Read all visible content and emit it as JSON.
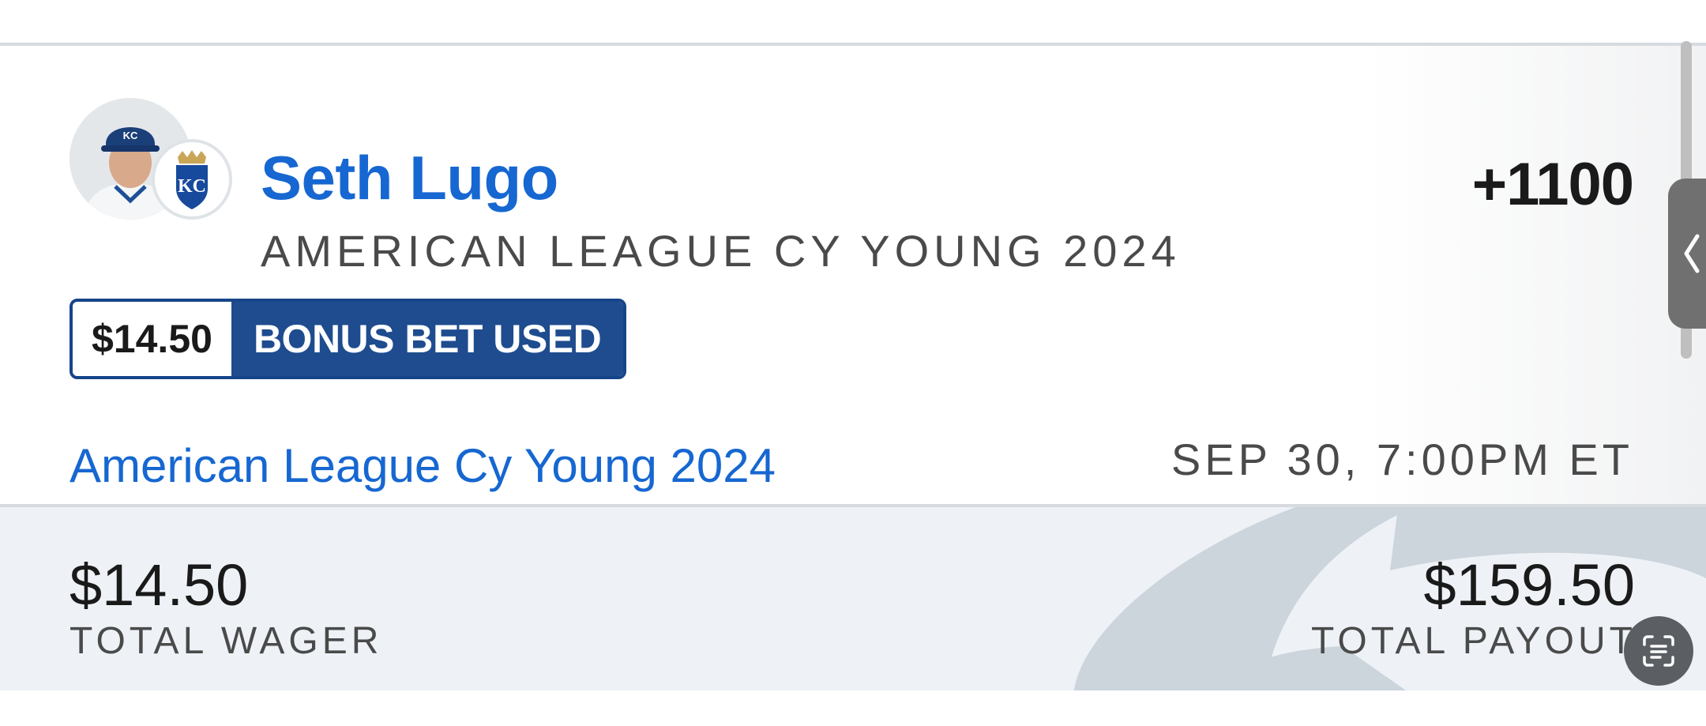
{
  "bet": {
    "player_name": "Seth Lugo",
    "market_subtitle": "AMERICAN LEAGUE CY YOUNG 2024",
    "odds": "+1100",
    "team_logo_text": "KC",
    "bonus_amount": "$14.50",
    "bonus_label": "BONUS BET USED",
    "event_name": "American League Cy Young 2024",
    "event_time": "SEP 30, 7:00PM ET"
  },
  "totals": {
    "wager_value": "$14.50",
    "wager_label": "TOTAL WAGER",
    "payout_value": "$159.50",
    "payout_label": "TOTAL PAYOUT"
  },
  "icons": {
    "player_photo": "player-headshot",
    "team_logo": "kansas-city-royals-logo",
    "side_handle": "chevron-left-icon",
    "scan": "text-scan-icon"
  },
  "colors": {
    "link_blue": "#1667d1",
    "badge_navy": "#1e4c8f",
    "footer_bg": "#eef2f7"
  }
}
